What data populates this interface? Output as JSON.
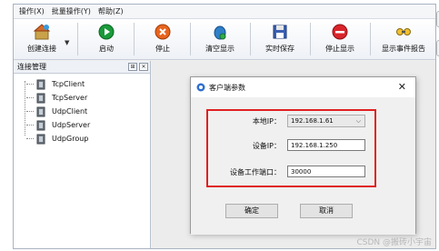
{
  "menubar": {
    "items": [
      "操作(X)",
      "批量操作(Y)",
      "帮助(Z)"
    ]
  },
  "toolbar": {
    "buttons": [
      {
        "label": "创建连接",
        "icon": "create-connection-icon"
      },
      {
        "label": "启动",
        "icon": "start-icon"
      },
      {
        "label": "停止",
        "icon": "stop-icon"
      },
      {
        "label": "清空显示",
        "icon": "clear-display-icon"
      },
      {
        "label": "实时保存",
        "icon": "save-icon"
      },
      {
        "label": "停止显示",
        "icon": "stop-display-icon"
      },
      {
        "label": "显示事件报告",
        "icon": "event-report-icon"
      }
    ]
  },
  "connection_panel": {
    "title": "连接管理",
    "items": [
      "TcpClient",
      "TcpServer",
      "UdpClient",
      "UdpServer",
      "UdpGroup"
    ]
  },
  "dialog": {
    "title": "客户端参数",
    "fields": {
      "local_ip_label": "本地IP：",
      "local_ip_value": "192.168.1.61",
      "device_ip_label": "设备IP：",
      "device_ip_value": "192.168.1.250",
      "device_port_label": "设备工作端口：",
      "device_port_value": "30000"
    },
    "ok_label": "确定",
    "cancel_label": "取消"
  },
  "watermark": "CSDN @搬砖小宇宙",
  "colors": {
    "highlight": "#e02020",
    "start_green": "#1a9a3a",
    "stop_orange": "#e8641e",
    "stop_display_red": "#d9252a"
  }
}
